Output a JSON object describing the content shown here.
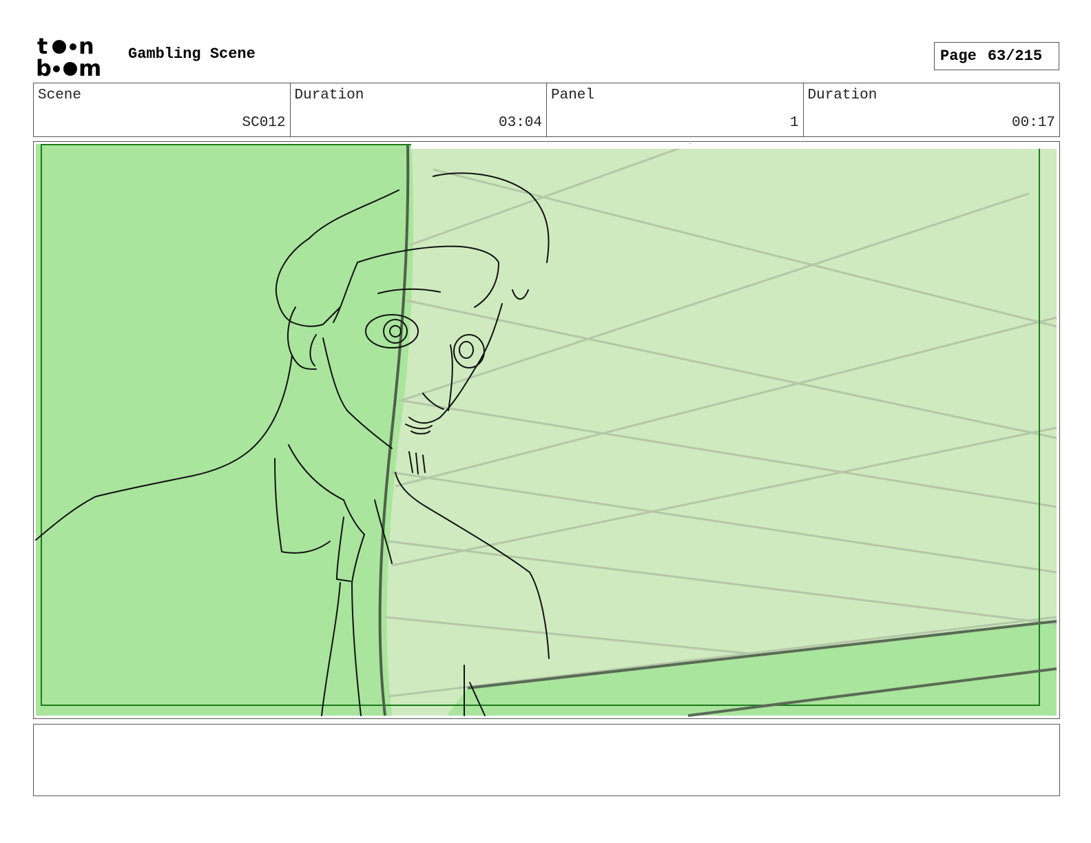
{
  "header": {
    "logo_icon": "toon-boom-logo",
    "logo_text": "toon boom",
    "project_title": "Gambling Scene",
    "page_label": "Page",
    "page_number": "63/215"
  },
  "info": [
    {
      "label": "Scene",
      "value": "SC012"
    },
    {
      "label": "Duration",
      "value": "03:04"
    },
    {
      "label": "Panel",
      "value": "1"
    },
    {
      "label": "Duration",
      "value": "00:17"
    }
  ],
  "panel": {
    "image_icon": "storyboard-sketch",
    "colors": {
      "bright_green": "#a9e59c",
      "pale_green": "#cfeabf",
      "frame_green": "#1c7a1c"
    }
  },
  "notes": {
    "text": ""
  }
}
